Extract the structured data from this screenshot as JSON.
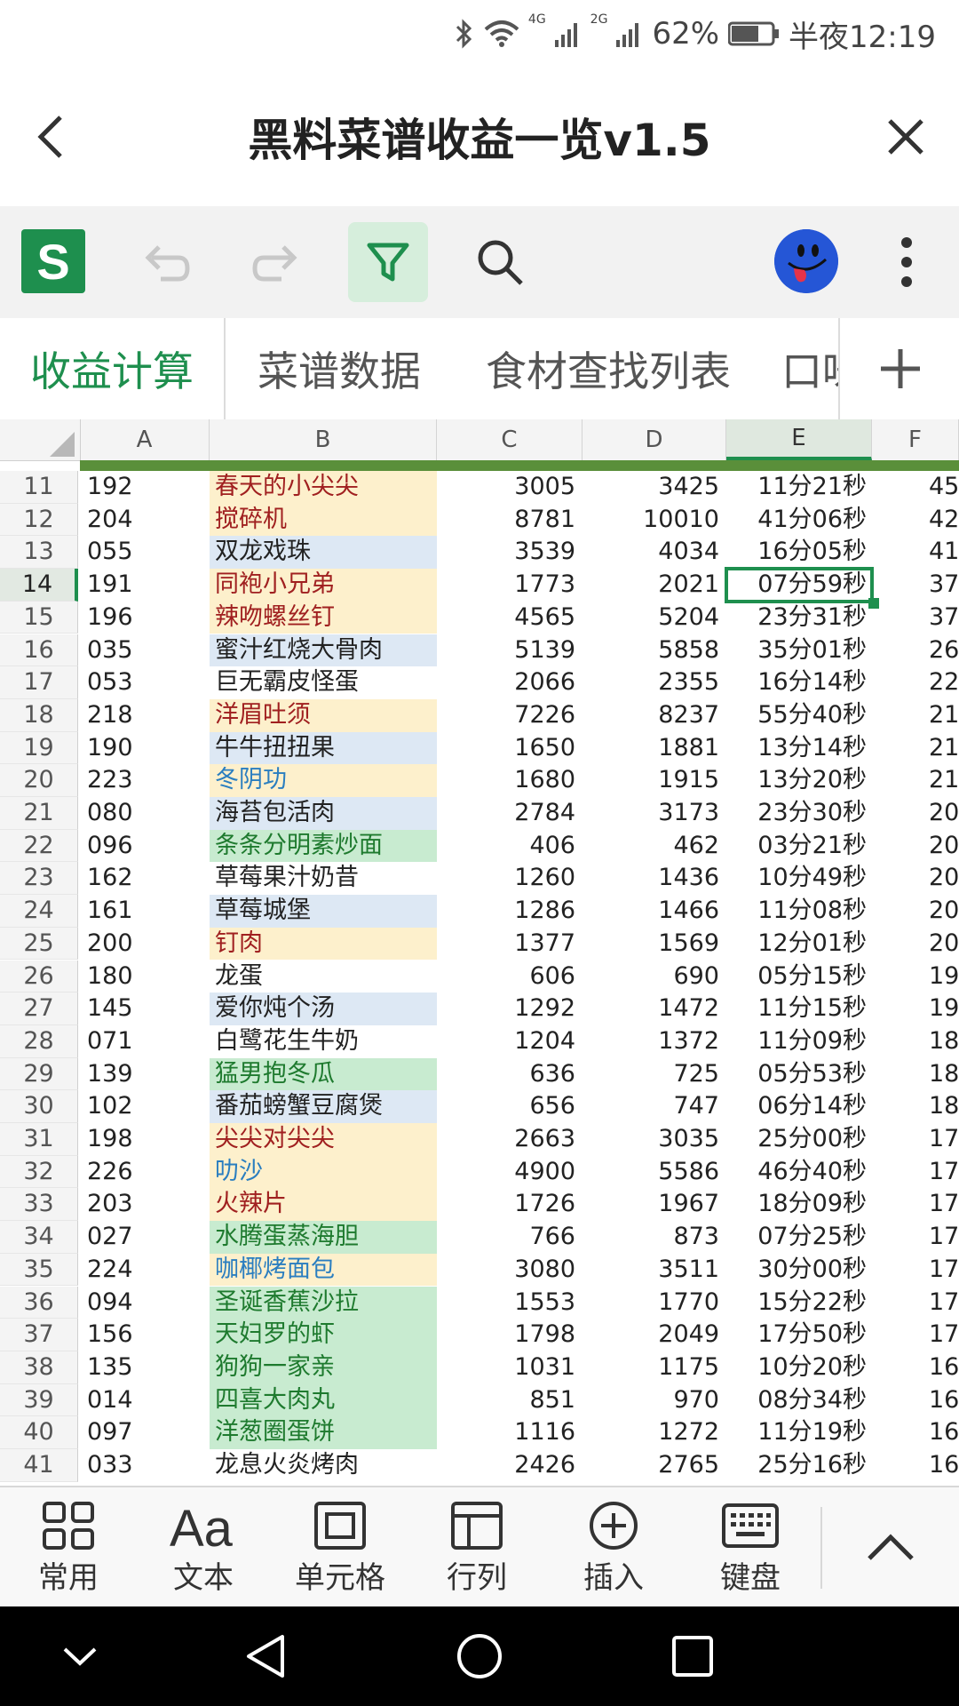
{
  "status_bar": {
    "battery": "62%",
    "network_4g": "4G",
    "network_2g": "2G",
    "time": "半夜12:19"
  },
  "title_bar": {
    "title": "黑料菜谱收益一览v1.5"
  },
  "toolbar": {
    "logo": "S",
    "icons": [
      "undo-icon",
      "redo-icon",
      "filter-icon",
      "search-icon",
      "avatar",
      "more-icon"
    ]
  },
  "sheet_tabs": {
    "tabs": [
      {
        "label": "收益计算",
        "active": true
      },
      {
        "label": "菜谱数据",
        "active": false
      },
      {
        "label": "食材查找列表",
        "active": false
      },
      {
        "label": "口味",
        "active": false
      }
    ],
    "add_icon": "plus-icon"
  },
  "grid": {
    "columns": [
      "A",
      "B",
      "C",
      "D",
      "E",
      "F"
    ],
    "selected_column": "E",
    "selected_row": "14",
    "rows": [
      {
        "rn": "11",
        "a": "192",
        "b": "春天的小尖尖",
        "c": "3005",
        "d": "3425",
        "e": "11分21秒",
        "f": "45",
        "fill": "#fdf0cc",
        "color": "#a02020"
      },
      {
        "rn": "12",
        "a": "204",
        "b": "搅碎机",
        "c": "8781",
        "d": "10010",
        "e": "41分06秒",
        "f": "42",
        "fill": "#fdf0cc",
        "color": "#a02020"
      },
      {
        "rn": "13",
        "a": "055",
        "b": "双龙戏珠",
        "c": "3539",
        "d": "4034",
        "e": "16分05秒",
        "f": "41",
        "fill": "#dde8f4",
        "color": "#222222"
      },
      {
        "rn": "14",
        "a": "191",
        "b": "同袍小兄弟",
        "c": "1773",
        "d": "2021",
        "e": "07分59秒",
        "f": "37",
        "fill": "#fdf0cc",
        "color": "#a02020"
      },
      {
        "rn": "15",
        "a": "196",
        "b": "辣吻螺丝钉",
        "c": "4565",
        "d": "5204",
        "e": "23分31秒",
        "f": "37",
        "fill": "#fdf0cc",
        "color": "#a02020"
      },
      {
        "rn": "16",
        "a": "035",
        "b": "蜜汁红烧大骨肉",
        "c": "5139",
        "d": "5858",
        "e": "35分01秒",
        "f": "26",
        "fill": "#dde8f4",
        "color": "#222222"
      },
      {
        "rn": "17",
        "a": "053",
        "b": "巨无霸皮怪蛋",
        "c": "2066",
        "d": "2355",
        "e": "16分14秒",
        "f": "22",
        "fill": "#ffffff",
        "color": "#222222"
      },
      {
        "rn": "18",
        "a": "218",
        "b": "洋眉吐须",
        "c": "7226",
        "d": "8237",
        "e": "55分40秒",
        "f": "21",
        "fill": "#fdf0cc",
        "color": "#a02020"
      },
      {
        "rn": "19",
        "a": "190",
        "b": "牛牛扭扭果",
        "c": "1650",
        "d": "1881",
        "e": "13分14秒",
        "f": "21",
        "fill": "#dde8f4",
        "color": "#222222"
      },
      {
        "rn": "20",
        "a": "223",
        "b": "冬阴功",
        "c": "1680",
        "d": "1915",
        "e": "13分20秒",
        "f": "21",
        "fill": "#fdf0cc",
        "color": "#2a7ec0"
      },
      {
        "rn": "21",
        "a": "080",
        "b": "海苔包活肉",
        "c": "2784",
        "d": "3173",
        "e": "23分30秒",
        "f": "20",
        "fill": "#dde8f4",
        "color": "#222222"
      },
      {
        "rn": "22",
        "a": "096",
        "b": "条条分明素炒面",
        "c": "406",
        "d": "462",
        "e": "03分21秒",
        "f": "20",
        "fill": "#c8ebd0",
        "color": "#1e7a2e"
      },
      {
        "rn": "23",
        "a": "162",
        "b": "草莓果汁奶昔",
        "c": "1260",
        "d": "1436",
        "e": "10分49秒",
        "f": "20",
        "fill": "#ffffff",
        "color": "#222222"
      },
      {
        "rn": "24",
        "a": "161",
        "b": "草莓城堡",
        "c": "1286",
        "d": "1466",
        "e": "11分08秒",
        "f": "20",
        "fill": "#dde8f4",
        "color": "#222222"
      },
      {
        "rn": "25",
        "a": "200",
        "b": "钉肉",
        "c": "1377",
        "d": "1569",
        "e": "12分01秒",
        "f": "20",
        "fill": "#fdf0cc",
        "color": "#a02020"
      },
      {
        "rn": "26",
        "a": "180",
        "b": "龙蛋",
        "c": "606",
        "d": "690",
        "e": "05分15秒",
        "f": "19",
        "fill": "#ffffff",
        "color": "#222222"
      },
      {
        "rn": "27",
        "a": "145",
        "b": "爱你炖个汤",
        "c": "1292",
        "d": "1472",
        "e": "11分15秒",
        "f": "19",
        "fill": "#dde8f4",
        "color": "#222222"
      },
      {
        "rn": "28",
        "a": "071",
        "b": "白鹭花生牛奶",
        "c": "1204",
        "d": "1372",
        "e": "11分09秒",
        "f": "18",
        "fill": "#ffffff",
        "color": "#222222"
      },
      {
        "rn": "29",
        "a": "139",
        "b": "猛男抱冬瓜",
        "c": "636",
        "d": "725",
        "e": "05分53秒",
        "f": "18",
        "fill": "#c8ebd0",
        "color": "#1e7a2e"
      },
      {
        "rn": "30",
        "a": "102",
        "b": "番茄螃蟹豆腐煲",
        "c": "656",
        "d": "747",
        "e": "06分14秒",
        "f": "18",
        "fill": "#dde8f4",
        "color": "#222222"
      },
      {
        "rn": "31",
        "a": "198",
        "b": "尖尖对尖尖",
        "c": "2663",
        "d": "3035",
        "e": "25分00秒",
        "f": "17",
        "fill": "#fdf0cc",
        "color": "#a02020"
      },
      {
        "rn": "32",
        "a": "226",
        "b": "叻沙",
        "c": "4900",
        "d": "5586",
        "e": "46分40秒",
        "f": "17",
        "fill": "#fdf0cc",
        "color": "#2a7ec0"
      },
      {
        "rn": "33",
        "a": "203",
        "b": "火辣片",
        "c": "1726",
        "d": "1967",
        "e": "18分09秒",
        "f": "17",
        "fill": "#fdf0cc",
        "color": "#a02020"
      },
      {
        "rn": "34",
        "a": "027",
        "b": "水腾蛋蒸海胆",
        "c": "766",
        "d": "873",
        "e": "07分25秒",
        "f": "17",
        "fill": "#c8ebd0",
        "color": "#1e7a2e"
      },
      {
        "rn": "35",
        "a": "224",
        "b": "咖椰烤面包",
        "c": "3080",
        "d": "3511",
        "e": "30分00秒",
        "f": "17",
        "fill": "#fdf0cc",
        "color": "#2a7ec0"
      },
      {
        "rn": "36",
        "a": "094",
        "b": "圣诞香蕉沙拉",
        "c": "1553",
        "d": "1770",
        "e": "15分22秒",
        "f": "17",
        "fill": "#c8ebd0",
        "color": "#1e7a2e"
      },
      {
        "rn": "37",
        "a": "156",
        "b": "天妇罗的虾",
        "c": "1798",
        "d": "2049",
        "e": "17分50秒",
        "f": "17",
        "fill": "#c8ebd0",
        "color": "#1e7a2e"
      },
      {
        "rn": "38",
        "a": "135",
        "b": "狗狗一家亲",
        "c": "1031",
        "d": "1175",
        "e": "10分20秒",
        "f": "16",
        "fill": "#c8ebd0",
        "color": "#1e7a2e"
      },
      {
        "rn": "39",
        "a": "014",
        "b": "四喜大肉丸",
        "c": "851",
        "d": "970",
        "e": "08分34秒",
        "f": "16",
        "fill": "#c8ebd0",
        "color": "#1e7a2e"
      },
      {
        "rn": "40",
        "a": "097",
        "b": "洋葱圈蛋饼",
        "c": "1116",
        "d": "1272",
        "e": "11分19秒",
        "f": "16",
        "fill": "#c8ebd0",
        "color": "#1e7a2e"
      },
      {
        "rn": "41",
        "a": "033",
        "b": "龙息火炎烤肉",
        "c": "2426",
        "d": "2765",
        "e": "25分16秒",
        "f": "16",
        "fill": "#ffffff",
        "color": "#222222"
      }
    ]
  },
  "bottom_bar": {
    "items": [
      {
        "label": "常用",
        "icon": "grid-icon"
      },
      {
        "label": "文本",
        "icon": "text-icon"
      },
      {
        "label": "单元格",
        "icon": "cell-icon"
      },
      {
        "label": "行列",
        "icon": "rowcol-icon"
      },
      {
        "label": "插入",
        "icon": "insert-icon"
      },
      {
        "label": "键盘",
        "icon": "keyboard-icon"
      }
    ],
    "expand_icon": "chevron-up-icon"
  },
  "nav_bar": {
    "icons": [
      "nav-down-icon",
      "nav-back-icon",
      "nav-home-icon",
      "nav-recent-icon"
    ]
  }
}
